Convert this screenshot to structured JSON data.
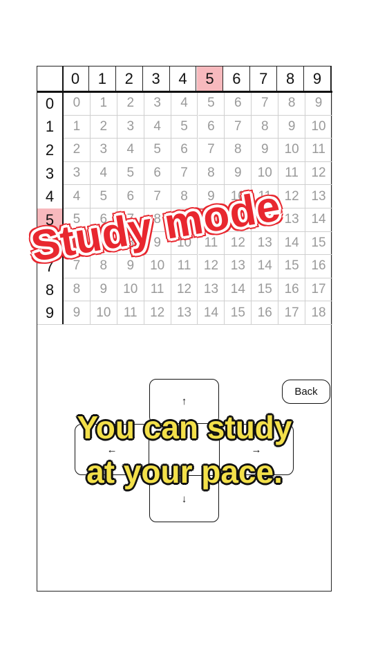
{
  "columns": [
    "0",
    "1",
    "2",
    "3",
    "4",
    "5",
    "6",
    "7",
    "8",
    "9"
  ],
  "rows": [
    "0",
    "1",
    "2",
    "3",
    "4",
    "5",
    "6",
    "7",
    "8",
    "9"
  ],
  "grid": [
    [
      "0",
      "1",
      "2",
      "3",
      "4",
      "5",
      "6",
      "7",
      "8",
      "9"
    ],
    [
      "1",
      "2",
      "3",
      "4",
      "5",
      "6",
      "7",
      "8",
      "9",
      "10"
    ],
    [
      "2",
      "3",
      "4",
      "5",
      "6",
      "7",
      "8",
      "9",
      "10",
      "11"
    ],
    [
      "3",
      "4",
      "5",
      "6",
      "7",
      "8",
      "9",
      "10",
      "11",
      "12"
    ],
    [
      "4",
      "5",
      "6",
      "7",
      "8",
      "9",
      "10",
      "11",
      "12",
      "13"
    ],
    [
      "5",
      "6",
      "7",
      "8",
      "9",
      "10",
      "11",
      "12",
      "13",
      "14"
    ],
    [
      "6",
      "7",
      "8",
      "9",
      "10",
      "11",
      "12",
      "13",
      "14",
      "15"
    ],
    [
      "7",
      "8",
      "9",
      "10",
      "11",
      "12",
      "13",
      "14",
      "15",
      "16"
    ],
    [
      "8",
      "9",
      "10",
      "11",
      "12",
      "13",
      "14",
      "15",
      "16",
      "17"
    ],
    [
      "9",
      "10",
      "11",
      "12",
      "13",
      "14",
      "15",
      "16",
      "17",
      "18"
    ]
  ],
  "selected": {
    "row": 5,
    "col": 5
  },
  "colors": {
    "highlight": "#f7b9bd",
    "selected_border": "#e8686f",
    "banner_red": "#e8272f",
    "caption_yellow": "#f3e04a"
  },
  "keys": {
    "up": "↑",
    "down": "↓",
    "left": "←",
    "right": "→"
  },
  "back_label": "Back",
  "overlay": {
    "title": "Study mode",
    "caption_line1": "You can study",
    "caption_line2": "at your pace."
  }
}
